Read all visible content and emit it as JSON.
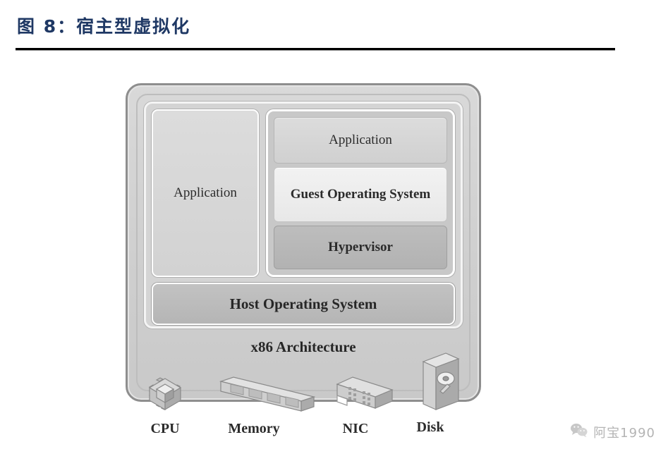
{
  "header": {
    "figure_title": "图 8：宿主型虚拟化"
  },
  "diagram": {
    "native_application": "Application",
    "vm": {
      "application": "Application",
      "guest_os": "Guest Operating System",
      "hypervisor": "Hypervisor"
    },
    "host_os": "Host Operating System",
    "architecture": "x86 Architecture",
    "hardware": [
      {
        "icon": "cpu-icon",
        "label": "CPU"
      },
      {
        "icon": "memory-icon",
        "label": "Memory"
      },
      {
        "icon": "nic-icon",
        "label": "NIC"
      },
      {
        "icon": "disk-icon",
        "label": "Disk"
      }
    ]
  },
  "watermark": {
    "icon": "wechat-icon",
    "text": "阿宝1990"
  },
  "colors": {
    "title": "#1f3864",
    "rule": "#000000",
    "chassis": "#cfcfcf",
    "panel": "#d4d4d4",
    "layer_application": "#d6d6d6",
    "layer_guest_os": "#ececec",
    "layer_hypervisor": "#b5b5b5",
    "host_os_bar": "#b8b8b8",
    "icon_gray": "#b0b0b0"
  }
}
